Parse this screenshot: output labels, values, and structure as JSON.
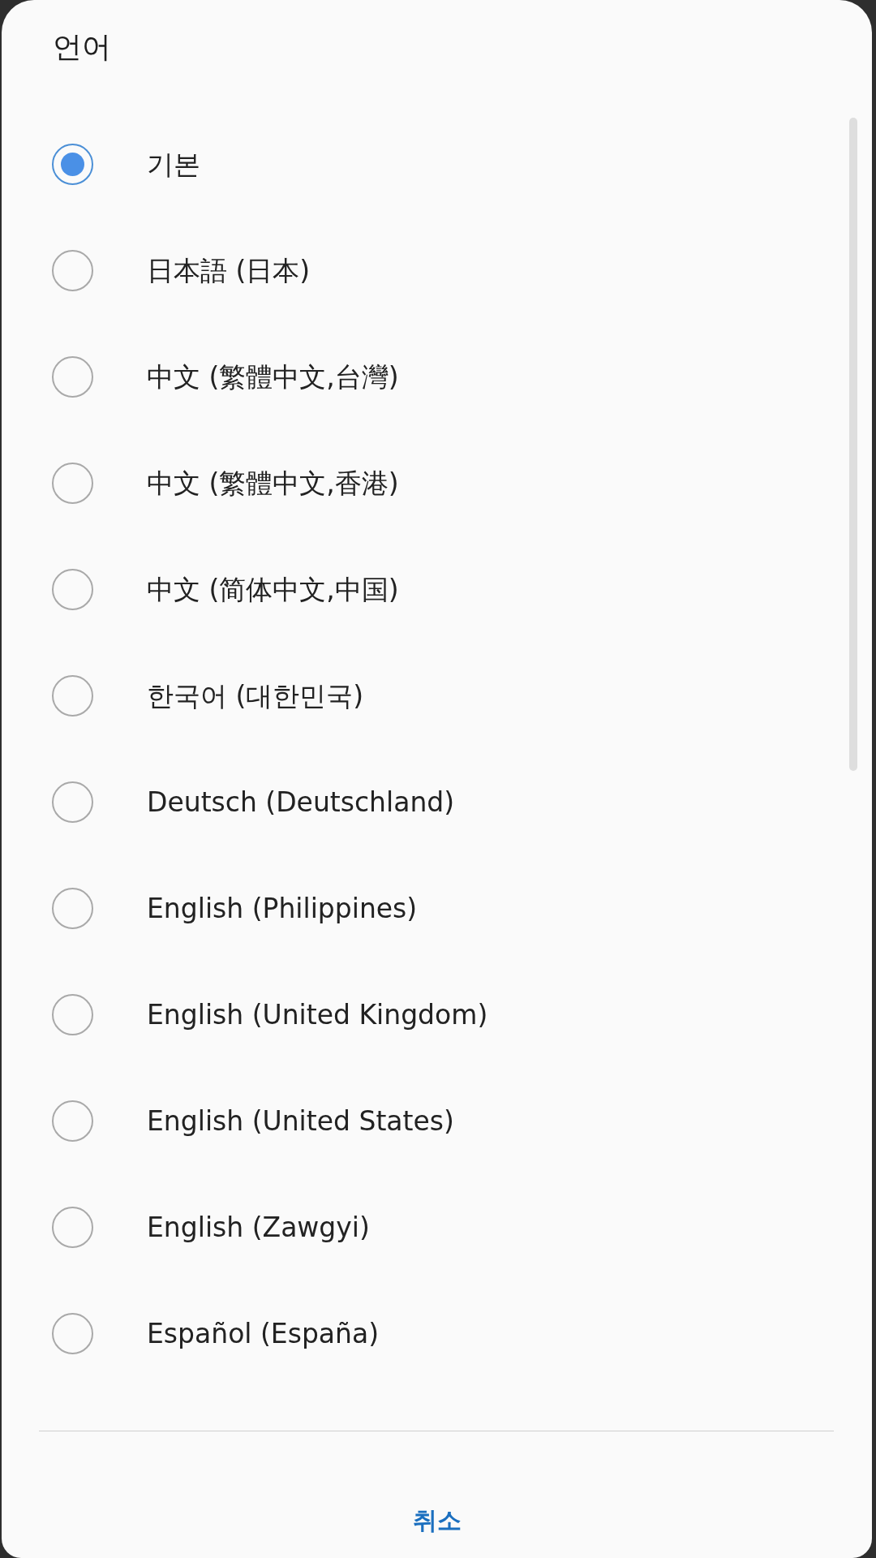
{
  "dialog": {
    "title": "언어",
    "options": [
      {
        "label": "기본",
        "selected": true
      },
      {
        "label": "日本語 (日本)",
        "selected": false
      },
      {
        "label": "中文 (繁體中文,台灣)",
        "selected": false
      },
      {
        "label": "中文 (繁體中文,香港)",
        "selected": false
      },
      {
        "label": "中文 (简体中文,中国)",
        "selected": false
      },
      {
        "label": "한국어 (대한민국)",
        "selected": false
      },
      {
        "label": "Deutsch (Deutschland)",
        "selected": false
      },
      {
        "label": "English (Philippines)",
        "selected": false
      },
      {
        "label": "English (United Kingdom)",
        "selected": false
      },
      {
        "label": "English (United States)",
        "selected": false
      },
      {
        "label": "English (Zawgyi)",
        "selected": false
      },
      {
        "label": "Español (España)",
        "selected": false
      }
    ],
    "cancel_button": {
      "label": "취소"
    }
  }
}
